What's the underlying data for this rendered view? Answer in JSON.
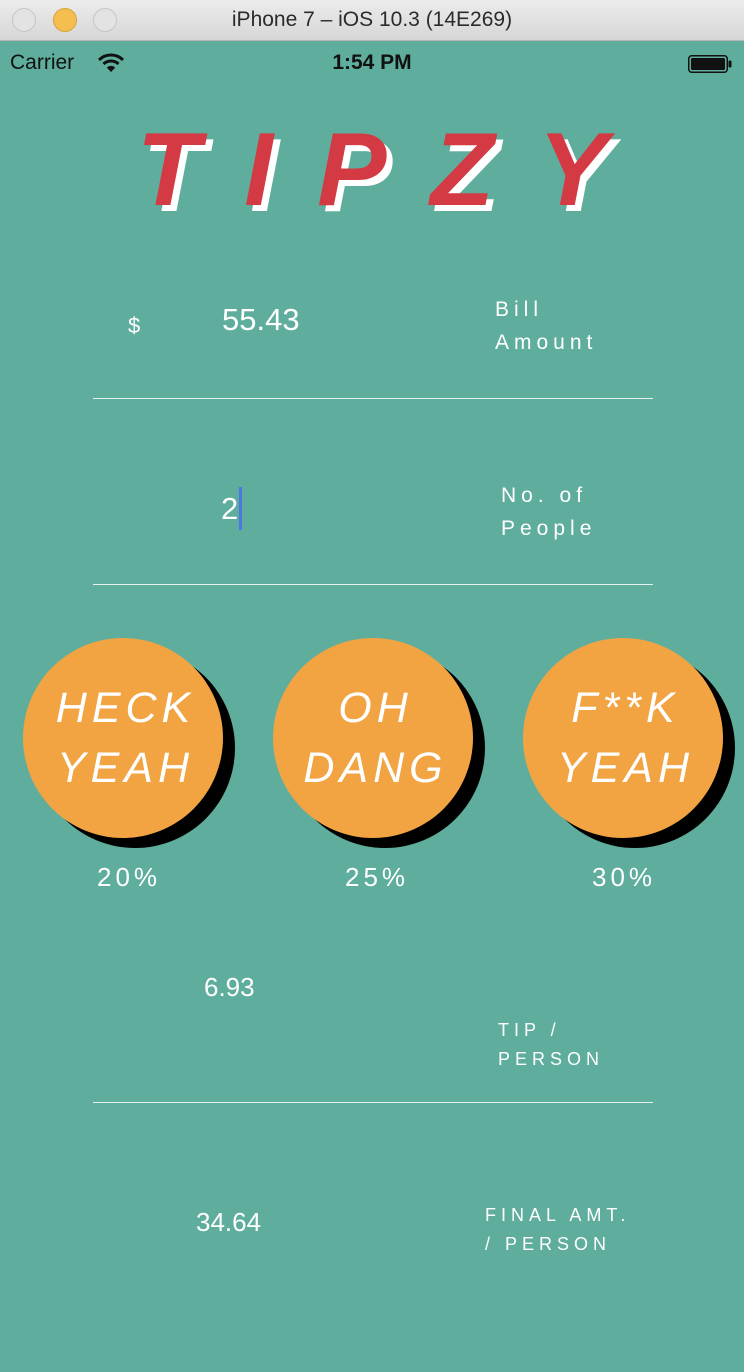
{
  "window": {
    "title": "iPhone 7 – iOS 10.3 (14E269)"
  },
  "status_bar": {
    "carrier": "Carrier",
    "time": "1:54 PM",
    "wifi_icon": "wifi-icon",
    "battery_icon": "battery-icon"
  },
  "app": {
    "logo": "TIPZY",
    "bill": {
      "currency": "$",
      "value": "55.43",
      "label_line1": "Bill",
      "label_line2": "Amount"
    },
    "people": {
      "value": "2",
      "label_line1": "No. of",
      "label_line2": "People"
    },
    "tip_options": [
      {
        "line1": "HECK",
        "line2": "YEAH",
        "percent": "20%"
      },
      {
        "line1": "OH",
        "line2": "DANG",
        "percent": "25%"
      },
      {
        "line1": "F**K",
        "line2": "YEAH",
        "percent": "30%"
      }
    ],
    "tip_per_person": {
      "value": "6.93",
      "label_line1": "TIP /",
      "label_line2": "PERSON"
    },
    "final_per_person": {
      "value": "34.64",
      "label_line1": "FINAL AMT.",
      "label_line2": "/ PERSON"
    }
  },
  "colors": {
    "background": "#5fae9d",
    "logo": "#d43a44",
    "button": "#f2a443",
    "caret": "#4b78e6"
  }
}
